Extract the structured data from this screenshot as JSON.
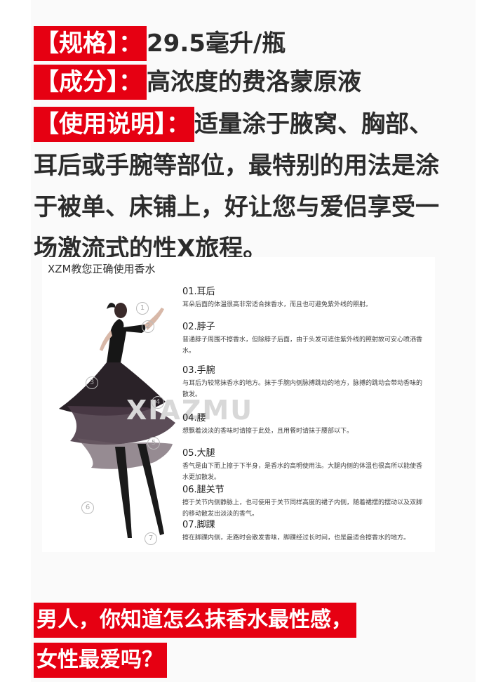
{
  "spec": {
    "tag": "【规格】：",
    "value": "29.5毫升/瓶"
  },
  "ingredient": {
    "tag": "【成分】：",
    "value": "高浓度的费洛蒙原液"
  },
  "usage": {
    "tag": "【使用说明】：",
    "text": "适量涂于腋窝、胸部、耳后或手腕等部位，最特别的用法是涂于被单、床铺上，好让您与爱侣享受一场激流式的性X旅程。"
  },
  "infographic": {
    "title": "XZM教您正确使用香水",
    "watermark": "XIAZMU",
    "markers": [
      "1",
      "2",
      "3",
      "4",
      "5",
      "6",
      "7"
    ],
    "steps": [
      {
        "heading": "01.耳后",
        "desc": "耳朵后面的体温很高非常适合抹香水，而且也可避免紫外线的照射。"
      },
      {
        "heading": "02.脖子",
        "desc": "普通脖子周围不擦香水，但除脖子后面，由于头发可遮住紫外线的照射故可安心喷洒香水。"
      },
      {
        "heading": "03.手腕",
        "desc": "与耳后为较常抹香水的地方。抹于手腕内侧脉搏跳动的地方，脉搏的跳动会带动香味的散发。"
      },
      {
        "heading": "04.腰",
        "desc": "想飘着淡淡的香味时请擦于此处，且用餐时请抹于腰部以下。"
      },
      {
        "heading": "05.大腿",
        "desc": "香气是由下而上擦于下半身，是香水的高明使用法。大腿内侧的体温也很高所以能使香水更加散发。"
      },
      {
        "heading": "06.腿关节",
        "desc": "擦于关节内侧静脉上，也可使用于关节同样高度的裙子内侧，随着裙摆的摆动以及双脚的移动散发出淡淡的香气。"
      },
      {
        "heading": "07.脚踝",
        "desc": "擦在脚踝内侧，走路时会散发香味，脚踝经过长时间，也是最适合擦香水的地方。"
      }
    ]
  },
  "bottom_banner": {
    "line1": "男人，你知道怎么抹香水最性感，",
    "line2": "女性最爱吗？"
  },
  "colors": {
    "accent": "#e60012",
    "text": "#2b2b2b"
  }
}
